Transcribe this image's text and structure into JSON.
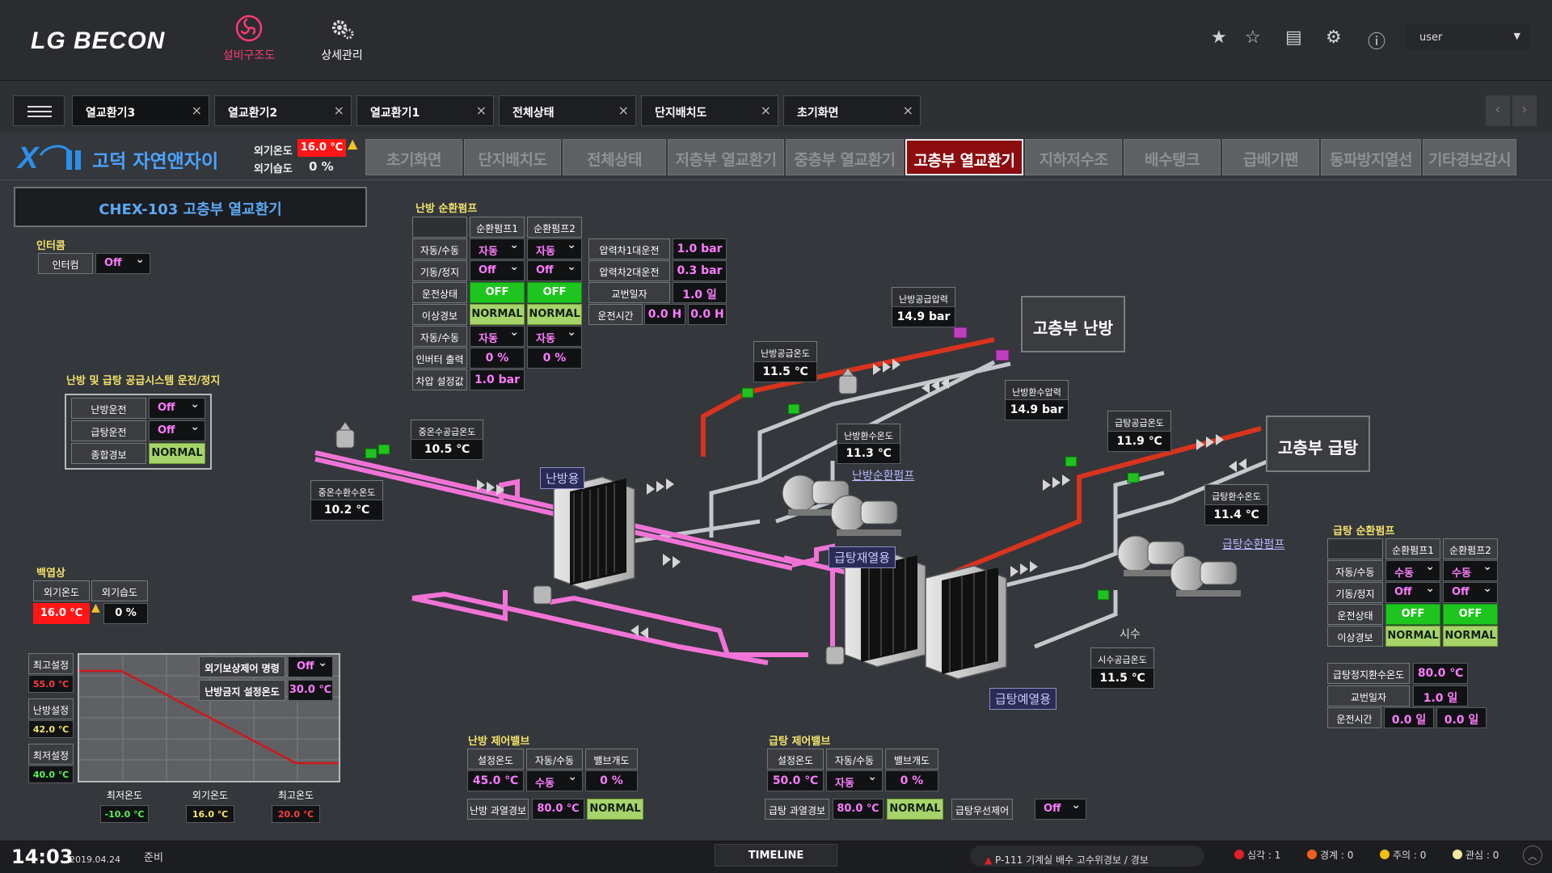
{
  "header": {
    "brand": "LG BECON",
    "nav": [
      {
        "label": "설비구조도",
        "icon": "fan-icon",
        "color": "#ff3b73"
      },
      {
        "label": "상세관리",
        "icon": "gears-icon"
      }
    ],
    "user": "user"
  },
  "tabs": [
    {
      "label": "열교환기3"
    },
    {
      "label": "열교환기2"
    },
    {
      "label": "열교환기1"
    },
    {
      "label": "전체상태"
    },
    {
      "label": "단지배치도"
    },
    {
      "label": "초기화면"
    }
  ],
  "site": {
    "name": "고덕 자연앤자이",
    "outer_temp_label": "외기온도",
    "outer_temp": "16.0 ℃",
    "outer_hum_label": "외기습도",
    "outer_hum": "0 %"
  },
  "subtabs": [
    "초기화면",
    "단지배치도",
    "전체상태",
    "저층부 열교환기",
    "중층부 열교환기",
    "고층부 열교환기",
    "지하저수조",
    "배수탱크",
    "급배기팬",
    "동파방지열선",
    "기타경보감시"
  ],
  "title": "CHEX-103 고층부 열교환기",
  "intercom": {
    "section": "인터콤",
    "label": "인터컴",
    "value": "Off"
  },
  "system": {
    "section": "난방 및 급탕 공급시스템 운전/정지",
    "rows": [
      {
        "label": "난방운전",
        "value": "Off"
      },
      {
        "label": "급탕운전",
        "value": "Off"
      },
      {
        "label": "종합경보",
        "value": "NORMAL"
      }
    ]
  },
  "weather": {
    "section": "백엽상",
    "temp_label": "외기온도",
    "hum_label": "외기습도",
    "temp": "16.0 ℃",
    "hum": "0 %"
  },
  "curve": {
    "max_label": "최고설정",
    "max_val": "55.0 ℃",
    "heat_label": "난방설정",
    "heat_val": "42.0 ℃",
    "min_label": "최저설정",
    "min_val": "40.0 ℃",
    "comp_label": "외기보상제어 명령",
    "comp_val": "Off",
    "stop_label": "난방금지 설정온도",
    "stop_val": "30.0 ℃",
    "low_label": "최저온도",
    "low_val": "-10.0 ℃",
    "out_label": "외기온도",
    "out_val": "16.0 ℃",
    "high_label": "최고온도",
    "high_val": "20.0 ℃"
  },
  "heat_pump": {
    "section": "난방 순환펌프",
    "cols": [
      "순환펌프1",
      "순환펌프2"
    ],
    "rows": [
      {
        "label": "자동/수동",
        "v1": "자동",
        "v2": "자동"
      },
      {
        "label": "기동/정지",
        "v1": "Off",
        "v2": "Off"
      },
      {
        "label": "운전상태",
        "v1": "OFF",
        "v2": "OFF"
      },
      {
        "label": "이상경보",
        "v1": "NORMAL",
        "v2": "NORMAL"
      },
      {
        "label": "자동/수동",
        "v1": "자동",
        "v2": "자동"
      },
      {
        "label": "인버터 출력",
        "v1": "0 %",
        "v2": "0 %"
      }
    ],
    "diff_label": "차압 설정값",
    "diff_val": "1.0 bar",
    "info": [
      {
        "label": "압력차1대운전",
        "val": "1.0 bar"
      },
      {
        "label": "압력차2대운전",
        "val": "0.3 bar"
      },
      {
        "label": "교번일자",
        "val": "1.0 일"
      },
      {
        "label": "운전시간",
        "v1": "0.0 H",
        "v2": "0.0 H"
      }
    ]
  },
  "diagram": {
    "hot_supply_p_label": "난방공급압력",
    "hot_supply_p": "14.9 bar",
    "hot_return_p_label": "난방환수압력",
    "hot_return_p": "14.9 bar",
    "hot_supply_t_label": "난방공급온도",
    "hot_supply_t": "11.5 ℃",
    "hot_return_t_label": "난방환수온도",
    "hot_return_t": "11.3 ℃",
    "mid_supply_label": "중온수공급온도",
    "mid_supply": "10.5 ℃",
    "mid_return_label": "중온수환수온도",
    "mid_return": "10.2 ℃",
    "dhw_supply_label": "급탕공급온도",
    "dhw_supply": "11.9 ℃",
    "dhw_return_label": "급탕환수온도",
    "dhw_return": "11.4 ℃",
    "city_supply_label": "시수공급온도",
    "city_supply": "11.5 ℃",
    "heating_area": "고층부 난방",
    "dhw_area": "고층부 급탕",
    "tag_heating": "난방용",
    "tag_reheat": "급탕재열용",
    "tag_preheat": "급탕예열용",
    "heat_pump_link": "난방순환펌프",
    "dhw_pump_link": "급탕순환펌프",
    "city_label": "시수"
  },
  "dhw_pump": {
    "section": "급탕 순환펌프",
    "cols": [
      "순환펌프1",
      "순환펌프2"
    ],
    "rows": [
      {
        "label": "자동/수동",
        "v1": "수동",
        "v2": "수동"
      },
      {
        "label": "기동/정지",
        "v1": "Off",
        "v2": "Off"
      },
      {
        "label": "운전상태",
        "v1": "OFF",
        "v2": "OFF"
      },
      {
        "label": "이상경보",
        "v1": "NORMAL",
        "v2": "NORMAL"
      }
    ],
    "stop_label": "급탕정지환수온도",
    "stop_val": "80.0 ℃",
    "alt_label": "교번일자",
    "alt_val": "1.0 일",
    "run_label": "운전시간",
    "run_v1": "0.0 일",
    "run_v2": "0.0 일"
  },
  "heat_valve": {
    "section": "난방 제어밸브",
    "cols": [
      "설정온도",
      "자동/수동",
      "밸브개도"
    ],
    "vals": [
      "45.0 ℃",
      "수동",
      "0 %"
    ],
    "alarm_label": "난방 과열경보",
    "alarm_temp": "80.0 ℃",
    "alarm_state": "NORMAL"
  },
  "dhw_valve": {
    "section": "급탕 제어밸브",
    "cols": [
      "설정온도",
      "자동/수동",
      "밸브개도"
    ],
    "vals": [
      "50.0 ℃",
      "자동",
      "0 %"
    ],
    "alarm_label": "급탕 과열경보",
    "alarm_temp": "80.0 ℃",
    "alarm_state": "NORMAL",
    "priority_label": "급탕우선제어",
    "priority_val": "Off"
  },
  "status": {
    "time": "14:03",
    "date": "2019.04.24",
    "state": "준비",
    "timeline": "TIMELINE",
    "alarm_text": "P-111 기계실 배수 고수위경보 / 경보",
    "counts": [
      {
        "label": "심각 : 1",
        "color": "#e0202a"
      },
      {
        "label": "경계 : 0",
        "color": "#f06020"
      },
      {
        "label": "주의 : 0",
        "color": "#f0c010"
      },
      {
        "label": "관심 : 0",
        "color": "#f5e8a0"
      }
    ]
  }
}
